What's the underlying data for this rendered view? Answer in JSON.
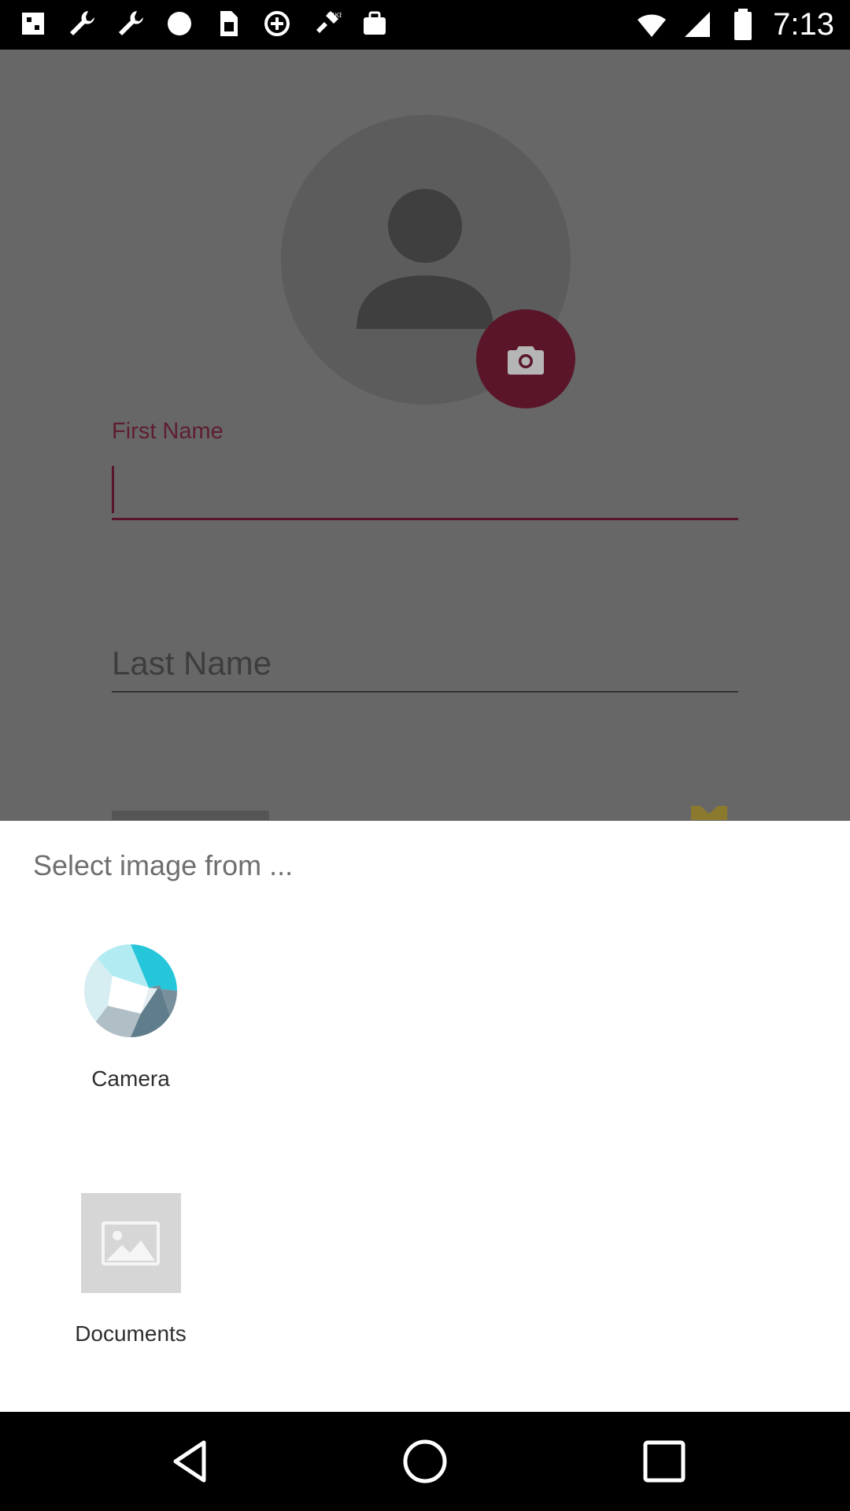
{
  "status_bar": {
    "time": "7:13",
    "left_icons": [
      "notification-icon",
      "wrench-icon",
      "wrench-icon",
      "circle-icon",
      "sim-icon",
      "data-saver-icon",
      "fake-gps-icon",
      "bag-icon"
    ],
    "right_icons": [
      "wifi-icon",
      "signal-icon",
      "battery-icon"
    ]
  },
  "form": {
    "first_name_label": "First Name",
    "first_name_value": "",
    "last_name_placeholder": "Last Name",
    "accent_color": "#5a1529"
  },
  "chooser": {
    "title": "Select image from ...",
    "options": [
      {
        "label": "Camera",
        "icon": "camera-aperture-icon"
      },
      {
        "label": "Documents",
        "icon": "image-placeholder-icon"
      }
    ]
  },
  "nav_bar": {
    "buttons": [
      "back-icon",
      "home-icon",
      "recents-icon"
    ]
  }
}
